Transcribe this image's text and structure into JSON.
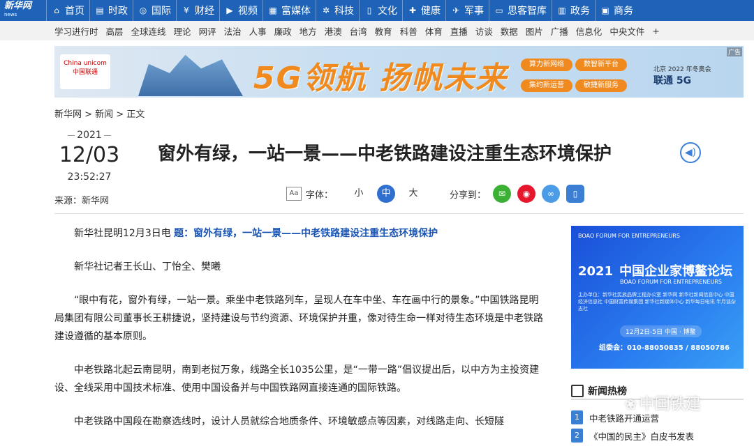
{
  "logo": {
    "line1": "新华网",
    "line2": "news"
  },
  "topnav": [
    {
      "icon": "home-icon",
      "glyph": "⌂",
      "label": "首页"
    },
    {
      "icon": "politics-icon",
      "glyph": "▤",
      "label": "时政"
    },
    {
      "icon": "globe-icon",
      "glyph": "◎",
      "label": "国际"
    },
    {
      "icon": "finance-icon",
      "glyph": "¥",
      "label": "财经"
    },
    {
      "icon": "video-icon",
      "glyph": "▶",
      "label": "视频"
    },
    {
      "icon": "media-icon",
      "glyph": "▦",
      "label": "富媒体"
    },
    {
      "icon": "tech-icon",
      "glyph": "✲",
      "label": "科技"
    },
    {
      "icon": "culture-icon",
      "glyph": "▯",
      "label": "文化"
    },
    {
      "icon": "health-icon",
      "glyph": "✚",
      "label": "健康"
    },
    {
      "icon": "military-icon",
      "glyph": "✈",
      "label": "军事"
    },
    {
      "icon": "thinktank-icon",
      "glyph": "▭",
      "label": "思客智库"
    },
    {
      "icon": "gov-icon",
      "glyph": "▥",
      "label": "政务"
    },
    {
      "icon": "business-icon",
      "glyph": "▣",
      "label": "商务"
    }
  ],
  "subnav": [
    "学习进行时",
    "高层",
    "全球连线",
    "理论",
    "网评",
    "法治",
    "人事",
    "廉政",
    "地方",
    "港澳",
    "台湾",
    "教育",
    "科普",
    "体育",
    "直播",
    "访谈",
    "数据",
    "图片",
    "广播",
    "信息化",
    "中央文件",
    "+"
  ],
  "banner": {
    "unicom": "China unicom 中国联通",
    "slogan": "5G领航 扬帆未来",
    "pills": [
      "算力新网络",
      "数智新平台",
      "集约新运营",
      "敏捷新服务"
    ],
    "brand_top": "北京 2022 年冬奥会",
    "brand": "联通 5G",
    "ad_tag": "广告"
  },
  "breadcrumb": "新华网 > 新闻 > 正文",
  "date": {
    "year": "2021",
    "md": "12/03",
    "time": "23:52:27"
  },
  "source": "来源：新华网",
  "title": "窗外有绿，一站一景——中老铁路建设注重生态环境保护",
  "tools": {
    "font_label": "字体：",
    "sizes": [
      "小",
      "中",
      "大"
    ],
    "share_label": "分享到："
  },
  "article": {
    "p1_prefix": "新华社昆明12月3日电 ",
    "p1_title": "题：窗外有绿，一站一景——中老铁路建设注重生态环境保护",
    "p2": "新华社记者王长山、丁怡全、樊曦",
    "p3": "“眼中有花，窗外有绿，一站一景。乘坐中老铁路列车，呈现人在车中坐、车在画中行的景象。”中国铁路昆明局集团有限公司董事长王耕捷说，坚持建设与节约资源、环境保护并重，像对待生命一样对待生态环境是中老铁路建设遵循的基本原则。",
    "p4": "中老铁路北起云南昆明，南到老挝万象，线路全长1035公里，是“一带一路”倡议提出后，以中方为主投资建设、全线采用中国技术标准、使用中国设备并与中国铁路网直接连通的国际铁路。",
    "p5": "中老铁路中国段在勘察选线时，设计人员就综合地质条件、环境敏感点等因素，对线路走向、长短隧"
  },
  "side_ad": {
    "top": "BOAO FORUM FOR ENTREPRENEURS",
    "year": "2021",
    "head": "中国企业家博鳌论坛",
    "sub": "BOAO FORUM FOR ENTREPRENEURS",
    "small": "主办单位：新华社民族品牌工程办公室 新华网 新华社新闻信息中心 中国经济信息社 中国财富传媒集团 新华社新媒体中心 新华每日电讯 半月谈杂志社",
    "date": "12月2日-5日 中国 · 博鳌",
    "phone": "组委会：010-88050835 / 88050786"
  },
  "hot": {
    "title": "新闻热榜",
    "items": [
      {
        "num": "1",
        "text": "中老铁路开通运营"
      },
      {
        "num": "2",
        "text": "《中国的民主》白皮书发表"
      }
    ]
  },
  "watermark": "中国铁建"
}
